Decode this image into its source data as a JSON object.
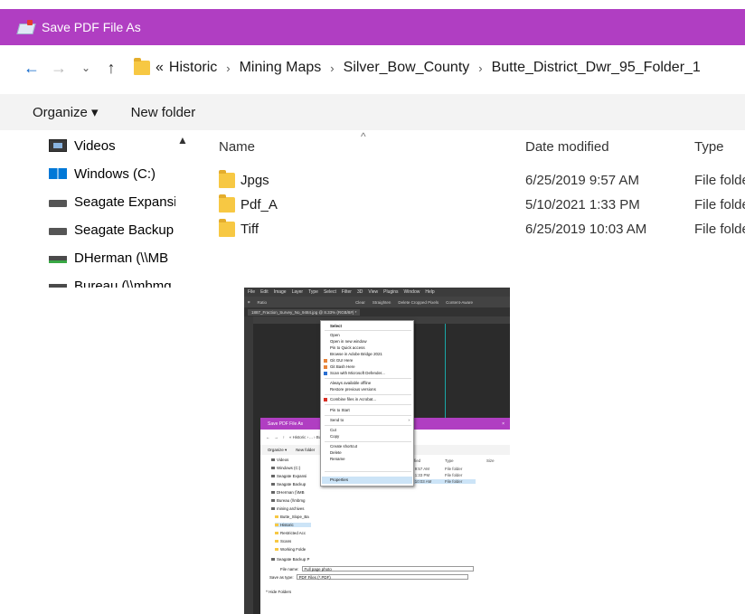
{
  "dialog": {
    "title": "Save PDF File As",
    "address": {
      "overflow": "«",
      "crumbs": [
        "Historic",
        "Mining Maps",
        "Silver_Bow_County",
        "Butte_District_Dwr_95_Folder_1"
      ]
    },
    "toolbar": {
      "organize": "Organize ▾",
      "new_folder": "New folder"
    },
    "nav_items": [
      {
        "label": "Videos",
        "icon": "videos-icon"
      },
      {
        "label": "Windows  (C:)",
        "icon": "windows-drive-icon"
      },
      {
        "label": "Seagate Expansion",
        "icon": "drive-icon"
      },
      {
        "label": "Seagate Backup",
        "icon": "drive-icon"
      },
      {
        "label": "DHerman (\\\\MB",
        "icon": "network-drive-icon"
      },
      {
        "label": "Bureau (\\\\mbmg",
        "icon": "network-drive-icon"
      }
    ],
    "columns": {
      "name": "Name",
      "date": "Date modified",
      "type": "Type"
    },
    "files": [
      {
        "name": "Jpgs",
        "date": "6/25/2019 9:57 AM",
        "type": "File folder"
      },
      {
        "name": "Pdf_A",
        "date": "5/10/2021 1:33 PM",
        "type": "File folder"
      },
      {
        "name": "Tiff",
        "date": "6/25/2019 10:03 AM",
        "type": "File folder"
      }
    ]
  },
  "thumb": {
    "menubar": [
      "File",
      "Edit",
      "Image",
      "Layer",
      "Type",
      "Select",
      "Filter",
      "3D",
      "View",
      "Plugins",
      "Window",
      "Help"
    ],
    "options": [
      "Ratio",
      "Clear",
      "Straighten",
      "Delete Cropped Pixels",
      "Content-Aware"
    ],
    "doc_tab": "1887_Fraction_Survey_No_9484.jpg @ 8.33% (RGB/8#) *",
    "context_menu": [
      "Select",
      "Open",
      "Open in new window",
      "Pin to Quick access",
      "Browse in Adobe Bridge 2021",
      "Git GUI Here",
      "Git Bash Here",
      "Scan with Microsoft Defender...",
      "Always available offline",
      "Restore previous versions",
      "Combine files in Acrobat...",
      "Pin to Start",
      "Send to",
      "Cut",
      "Copy",
      "Create shortcut",
      "Delete",
      "Rename",
      "Properties"
    ],
    "dialog": {
      "title": "Save PDF File As",
      "address": "« Historic › ... › Butte_District_Dwr_95_Folder_1",
      "organize": "Organize ▾",
      "new_folder": "New folder",
      "col_date": "Date modified",
      "col_type": "Type",
      "col_size": "Size",
      "nav": [
        "Videos",
        "Windows (C:)",
        "Seagate Expansi",
        "Seagate Backup",
        "DHerman (\\\\MB",
        "Bureau (\\\\mbmg",
        "mining archives",
        "Butte_Slope_Ba",
        "Historic",
        "Restricted Acc",
        "Scans",
        "Working Folde",
        "Seagate Backup P"
      ],
      "rows": [
        {
          "date": "6/25/2019 9:57 AM",
          "type": "File folder"
        },
        {
          "date": "5/10/2021 1:33 PM",
          "type": "File folder"
        },
        {
          "date": "6/25/2019 10:03 AM",
          "type": "File folder"
        }
      ],
      "file_name_label": "File name:",
      "file_name": "Full page photo",
      "save_type_label": "Save as type:",
      "save_type": "PDF Files (*.PDF)",
      "hide_folders": "^ Hide Folders"
    }
  }
}
